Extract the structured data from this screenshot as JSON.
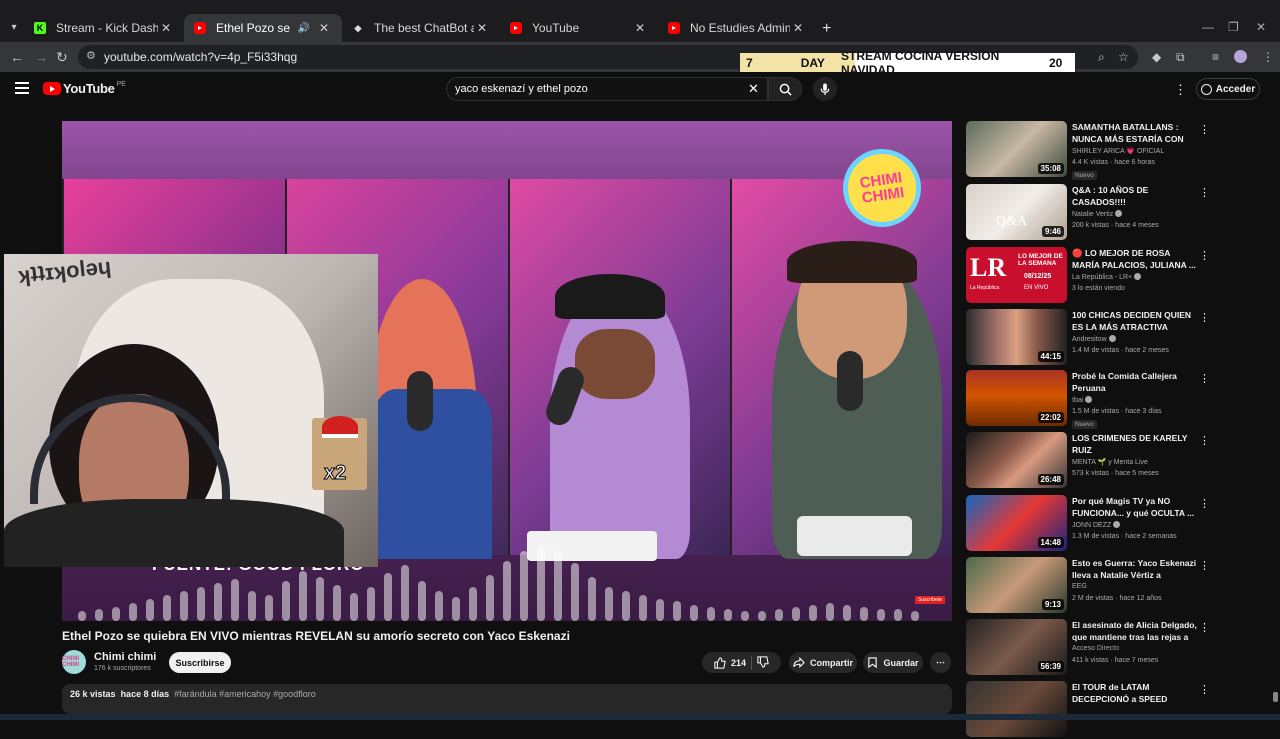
{
  "browser": {
    "tabs": [
      {
        "label": "Stream - Kick Dashboard",
        "favicon": "kick-icon",
        "active": false
      },
      {
        "label": "Ethel Pozo se quiebra EN VIVO",
        "favicon": "youtube-icon",
        "active": true
      },
      {
        "label": "The best ChatBot and Widgets",
        "favicon": "chatbot-icon",
        "active": false
      },
      {
        "label": "YouTube",
        "favicon": "youtube-icon",
        "active": false
      },
      {
        "label": "No Estudies Administración de",
        "favicon": "youtube-icon",
        "active": false
      }
    ],
    "url": "youtube.com/watch?v=4p_F5i33hqg"
  },
  "overlay": {
    "day_label": "7",
    "day_suffix": "DAY",
    "stream_title": "STREAM COCINA VERSION NAVIDAD",
    "counter": "20"
  },
  "youtube": {
    "logo_text": "YouTube",
    "country_code": "PE",
    "search_query": "yaco eskenazí y ethel pozo",
    "signin_label": "Acceder"
  },
  "video": {
    "source_caption": "FUENTE: GOOD FLORO",
    "channel_logo_text": "CHIMI CHIMI",
    "subscribe_tag": "Suscríbete",
    "title": "Ethel Pozo se quiebra EN VIVO mientras REVELAN su amorío secreto con Yaco Eskenazi",
    "channel_name": "Chimi chimi",
    "channel_subs": "176 k suscriptores",
    "subscribe_label": "Suscribirse",
    "likes": "214",
    "share_label": "Compartir",
    "save_label": "Guardar",
    "views": "26 k vistas",
    "age": "hace 8 días",
    "hashtags": "#farándula #americahoy #goodfloro"
  },
  "webcam": {
    "badge_text": "x2"
  },
  "recommendations": [
    {
      "title": "SAMANTHA BATALLANS : NUNCA MÁS ESTARÍA CON U...",
      "channel": "SHIRLEY ARICA 💗 OFICIAL",
      "meta": "4.4 K vistas · hace 6 horas",
      "duration": "35:08",
      "badge": "Nuevo",
      "verified": false
    },
    {
      "title": "Q&A : 10 AÑOS DE CASADOS!!!!",
      "channel": "Natalie Vertiz",
      "meta": "200 k vistas · hace 4 meses",
      "duration": "9:46",
      "badge": "",
      "verified": true
    },
    {
      "title": "🔴 LO MEJOR DE ROSA MARÍA PALACIOS, JULIANA ...",
      "channel": "La República - LR+",
      "meta": "3 lo están viendo",
      "duration": "",
      "badge": "",
      "verified": true
    },
    {
      "title": "100 CHICAS DECIDEN QUIEN ES LA MÁS ATRACTIVA",
      "channel": "Andresitow",
      "meta": "1.4 M de vistas · hace 2 meses",
      "duration": "44:15",
      "badge": "",
      "verified": true
    },
    {
      "title": "Probé la Comida Callejera Peruana",
      "channel": "Ibai",
      "meta": "1.5 M de vistas · hace 3 días",
      "duration": "22:02",
      "badge": "Nuevo",
      "verified": true
    },
    {
      "title": "LOS CRIMENES DE KARELY RUIZ",
      "channel": "MENTA 🌱 y Menta Live",
      "meta": "573 k vistas · hace 5 meses",
      "duration": "26:48",
      "badge": "",
      "verified": false
    },
    {
      "title": "Por qué Magis TV ya NO FUNCIONA... y qué OCULTA ...",
      "channel": "JONN DEZZ",
      "meta": "1.3 M de vistas · hace 2 semanas",
      "duration": "14:48",
      "badge": "",
      "verified": true
    },
    {
      "title": "Esto es Guerra: Yaco Eskenazi lleva a Natalie Vértiz a Gamarr...",
      "channel": "EEG",
      "meta": "2 M de vistas · hace 12 años",
      "duration": "9:13",
      "badge": "",
      "verified": false
    },
    {
      "title": "El asesinato de Alicia Delgado, que mantiene tras las rejas a l...",
      "channel": "Acceso Directo",
      "meta": "411 k vistas · hace 7 meses",
      "duration": "56:39",
      "badge": "",
      "verified": false
    },
    {
      "title": "El TOUR de LATAM DECEPCIONÓ a SPEED",
      "channel": "",
      "meta": "",
      "duration": "",
      "badge": "",
      "verified": false
    }
  ],
  "thumb_live": {
    "lr": "LR",
    "lr_sub": "La República",
    "header": "LO MEJOR DE LA SEMANA",
    "date": "08/12/25",
    "live": "EN VIVO"
  },
  "thumb_qa": "Q&A"
}
